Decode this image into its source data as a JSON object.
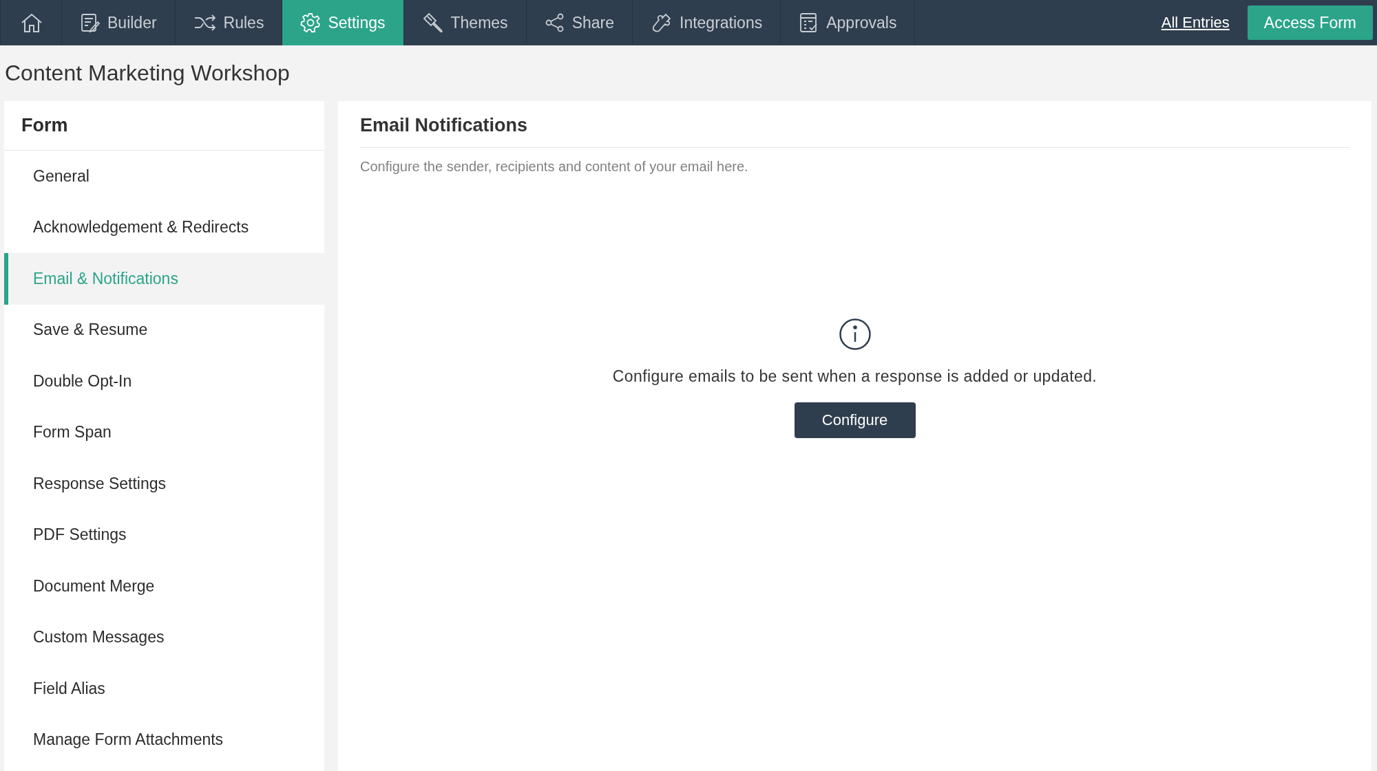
{
  "nav": {
    "tabs": [
      {
        "kind": "home",
        "selected": false
      },
      {
        "kind": "builder",
        "label": "Builder",
        "selected": false
      },
      {
        "kind": "rules",
        "label": "Rules",
        "selected": false
      },
      {
        "kind": "settings",
        "label": "Settings",
        "selected": true
      },
      {
        "kind": "themes",
        "label": "Themes",
        "selected": false
      },
      {
        "kind": "share",
        "label": "Share",
        "selected": false
      },
      {
        "kind": "integrations",
        "label": "Integrations",
        "selected": false
      },
      {
        "kind": "approvals",
        "label": "Approvals",
        "selected": false
      }
    ],
    "link": "All Entries",
    "button": "Access Form"
  },
  "page_title": "Content Marketing Workshop",
  "sidebar": {
    "title": "Form",
    "items": [
      {
        "label": "General",
        "selected": false
      },
      {
        "label": "Acknowledgement & Redirects",
        "selected": false
      },
      {
        "label": "Email & Notifications",
        "selected": true
      },
      {
        "label": "Save & Resume",
        "selected": false
      },
      {
        "label": "Double Opt-In",
        "selected": false
      },
      {
        "label": "Form Span",
        "selected": false
      },
      {
        "label": "Response Settings",
        "selected": false
      },
      {
        "label": "PDF Settings",
        "selected": false
      },
      {
        "label": "Document Merge",
        "selected": false
      },
      {
        "label": "Custom Messages",
        "selected": false
      },
      {
        "label": "Field Alias",
        "selected": false
      },
      {
        "label": "Manage Form Attachments",
        "selected": false
      }
    ]
  },
  "main": {
    "title": "Email Notifications",
    "description": "Configure the sender, recipients and content of your email here.",
    "empty_message": "Configure emails to be sent when a response is added or updated.",
    "button": "Configure"
  }
}
